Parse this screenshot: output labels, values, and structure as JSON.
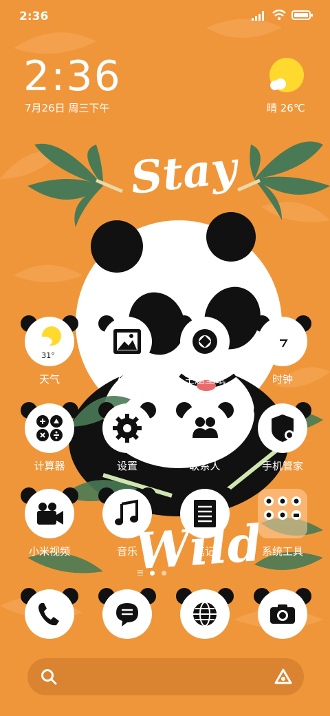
{
  "status_bar": {
    "time": "2:36",
    "icons": [
      "signal-icon",
      "wifi-icon",
      "battery-icon"
    ]
  },
  "clock_widget": {
    "time": "2:36",
    "date": "7月26日 周三下午"
  },
  "weather_widget": {
    "text": "晴 26℃",
    "icon": "sunny-icon"
  },
  "wallpaper": {
    "top_text": "Stay",
    "bottom_text": "Wild"
  },
  "apps": [
    {
      "label": "天气",
      "icon": "weather-icon",
      "badge": "31°"
    },
    {
      "label": "相册",
      "icon": "gallery-icon"
    },
    {
      "label": "主题壁纸",
      "icon": "theme-icon"
    },
    {
      "label": "时钟",
      "icon": "clock-icon"
    },
    {
      "label": "计算器",
      "icon": "calculator-icon"
    },
    {
      "label": "设置",
      "icon": "settings-icon"
    },
    {
      "label": "联系人",
      "icon": "contacts-icon"
    },
    {
      "label": "手机管家",
      "icon": "security-icon"
    },
    {
      "label": "小米视频",
      "icon": "video-icon"
    },
    {
      "label": "音乐",
      "icon": "music-icon"
    },
    {
      "label": "笔记",
      "icon": "notes-icon"
    },
    {
      "label": "系统工具",
      "icon": "folder-icon"
    }
  ],
  "dock": [
    {
      "icon": "phone-icon"
    },
    {
      "icon": "messages-icon"
    },
    {
      "icon": "browser-icon"
    },
    {
      "icon": "camera-icon"
    }
  ],
  "pages": {
    "count": 2,
    "active": 1
  },
  "search_bar": {
    "icon": "search-icon",
    "assistant_icon": "assistant-icon"
  },
  "colors": {
    "background": "#F0963A",
    "leaf": "#4A7A55",
    "sun": "#FFD92E"
  }
}
